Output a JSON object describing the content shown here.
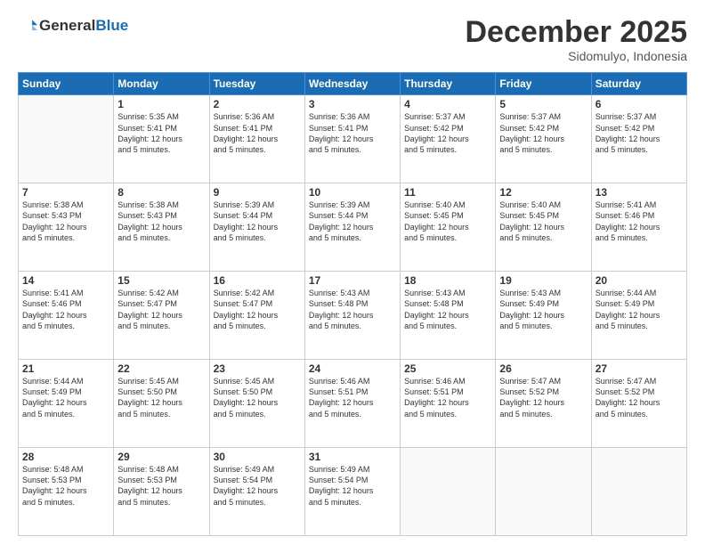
{
  "header": {
    "logo": {
      "general": "General",
      "blue": "Blue"
    },
    "title": "December 2025",
    "subtitle": "Sidomulyo, Indonesia"
  },
  "calendar": {
    "days_of_week": [
      "Sunday",
      "Monday",
      "Tuesday",
      "Wednesday",
      "Thursday",
      "Friday",
      "Saturday"
    ],
    "weeks": [
      [
        {
          "day": "",
          "info": ""
        },
        {
          "day": "1",
          "info": "Sunrise: 5:35 AM\nSunset: 5:41 PM\nDaylight: 12 hours\nand 5 minutes."
        },
        {
          "day": "2",
          "info": "Sunrise: 5:36 AM\nSunset: 5:41 PM\nDaylight: 12 hours\nand 5 minutes."
        },
        {
          "day": "3",
          "info": "Sunrise: 5:36 AM\nSunset: 5:41 PM\nDaylight: 12 hours\nand 5 minutes."
        },
        {
          "day": "4",
          "info": "Sunrise: 5:37 AM\nSunset: 5:42 PM\nDaylight: 12 hours\nand 5 minutes."
        },
        {
          "day": "5",
          "info": "Sunrise: 5:37 AM\nSunset: 5:42 PM\nDaylight: 12 hours\nand 5 minutes."
        },
        {
          "day": "6",
          "info": "Sunrise: 5:37 AM\nSunset: 5:42 PM\nDaylight: 12 hours\nand 5 minutes."
        }
      ],
      [
        {
          "day": "7",
          "info": "Sunrise: 5:38 AM\nSunset: 5:43 PM\nDaylight: 12 hours\nand 5 minutes."
        },
        {
          "day": "8",
          "info": "Sunrise: 5:38 AM\nSunset: 5:43 PM\nDaylight: 12 hours\nand 5 minutes."
        },
        {
          "day": "9",
          "info": "Sunrise: 5:39 AM\nSunset: 5:44 PM\nDaylight: 12 hours\nand 5 minutes."
        },
        {
          "day": "10",
          "info": "Sunrise: 5:39 AM\nSunset: 5:44 PM\nDaylight: 12 hours\nand 5 minutes."
        },
        {
          "day": "11",
          "info": "Sunrise: 5:40 AM\nSunset: 5:45 PM\nDaylight: 12 hours\nand 5 minutes."
        },
        {
          "day": "12",
          "info": "Sunrise: 5:40 AM\nSunset: 5:45 PM\nDaylight: 12 hours\nand 5 minutes."
        },
        {
          "day": "13",
          "info": "Sunrise: 5:41 AM\nSunset: 5:46 PM\nDaylight: 12 hours\nand 5 minutes."
        }
      ],
      [
        {
          "day": "14",
          "info": "Sunrise: 5:41 AM\nSunset: 5:46 PM\nDaylight: 12 hours\nand 5 minutes."
        },
        {
          "day": "15",
          "info": "Sunrise: 5:42 AM\nSunset: 5:47 PM\nDaylight: 12 hours\nand 5 minutes."
        },
        {
          "day": "16",
          "info": "Sunrise: 5:42 AM\nSunset: 5:47 PM\nDaylight: 12 hours\nand 5 minutes."
        },
        {
          "day": "17",
          "info": "Sunrise: 5:43 AM\nSunset: 5:48 PM\nDaylight: 12 hours\nand 5 minutes."
        },
        {
          "day": "18",
          "info": "Sunrise: 5:43 AM\nSunset: 5:48 PM\nDaylight: 12 hours\nand 5 minutes."
        },
        {
          "day": "19",
          "info": "Sunrise: 5:43 AM\nSunset: 5:49 PM\nDaylight: 12 hours\nand 5 minutes."
        },
        {
          "day": "20",
          "info": "Sunrise: 5:44 AM\nSunset: 5:49 PM\nDaylight: 12 hours\nand 5 minutes."
        }
      ],
      [
        {
          "day": "21",
          "info": "Sunrise: 5:44 AM\nSunset: 5:49 PM\nDaylight: 12 hours\nand 5 minutes."
        },
        {
          "day": "22",
          "info": "Sunrise: 5:45 AM\nSunset: 5:50 PM\nDaylight: 12 hours\nand 5 minutes."
        },
        {
          "day": "23",
          "info": "Sunrise: 5:45 AM\nSunset: 5:50 PM\nDaylight: 12 hours\nand 5 minutes."
        },
        {
          "day": "24",
          "info": "Sunrise: 5:46 AM\nSunset: 5:51 PM\nDaylight: 12 hours\nand 5 minutes."
        },
        {
          "day": "25",
          "info": "Sunrise: 5:46 AM\nSunset: 5:51 PM\nDaylight: 12 hours\nand 5 minutes."
        },
        {
          "day": "26",
          "info": "Sunrise: 5:47 AM\nSunset: 5:52 PM\nDaylight: 12 hours\nand 5 minutes."
        },
        {
          "day": "27",
          "info": "Sunrise: 5:47 AM\nSunset: 5:52 PM\nDaylight: 12 hours\nand 5 minutes."
        }
      ],
      [
        {
          "day": "28",
          "info": "Sunrise: 5:48 AM\nSunset: 5:53 PM\nDaylight: 12 hours\nand 5 minutes."
        },
        {
          "day": "29",
          "info": "Sunrise: 5:48 AM\nSunset: 5:53 PM\nDaylight: 12 hours\nand 5 minutes."
        },
        {
          "day": "30",
          "info": "Sunrise: 5:49 AM\nSunset: 5:54 PM\nDaylight: 12 hours\nand 5 minutes."
        },
        {
          "day": "31",
          "info": "Sunrise: 5:49 AM\nSunset: 5:54 PM\nDaylight: 12 hours\nand 5 minutes."
        },
        {
          "day": "",
          "info": ""
        },
        {
          "day": "",
          "info": ""
        },
        {
          "day": "",
          "info": ""
        }
      ]
    ]
  }
}
